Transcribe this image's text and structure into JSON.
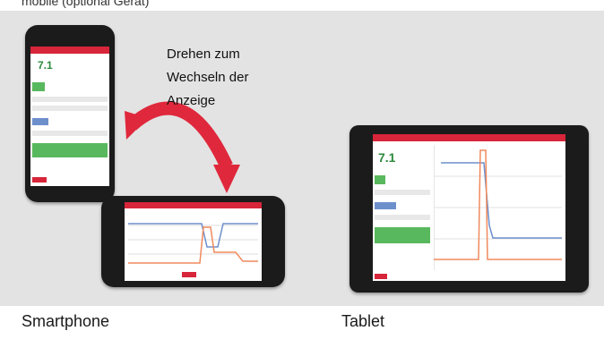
{
  "header": {
    "partial_text": "mobile (optional Gerät)"
  },
  "instruction": {
    "line1": "Drehen zum",
    "line2": "Wechseln der",
    "line3": "Anzeige"
  },
  "captions": {
    "smartphone": "Smartphone",
    "tablet": "Tablet"
  },
  "app": {
    "value": "7.1"
  },
  "colors": {
    "accent": "#d7253a",
    "green": "#58b85d",
    "blue": "#6d8fcc",
    "panel": "#e3e3e3"
  }
}
